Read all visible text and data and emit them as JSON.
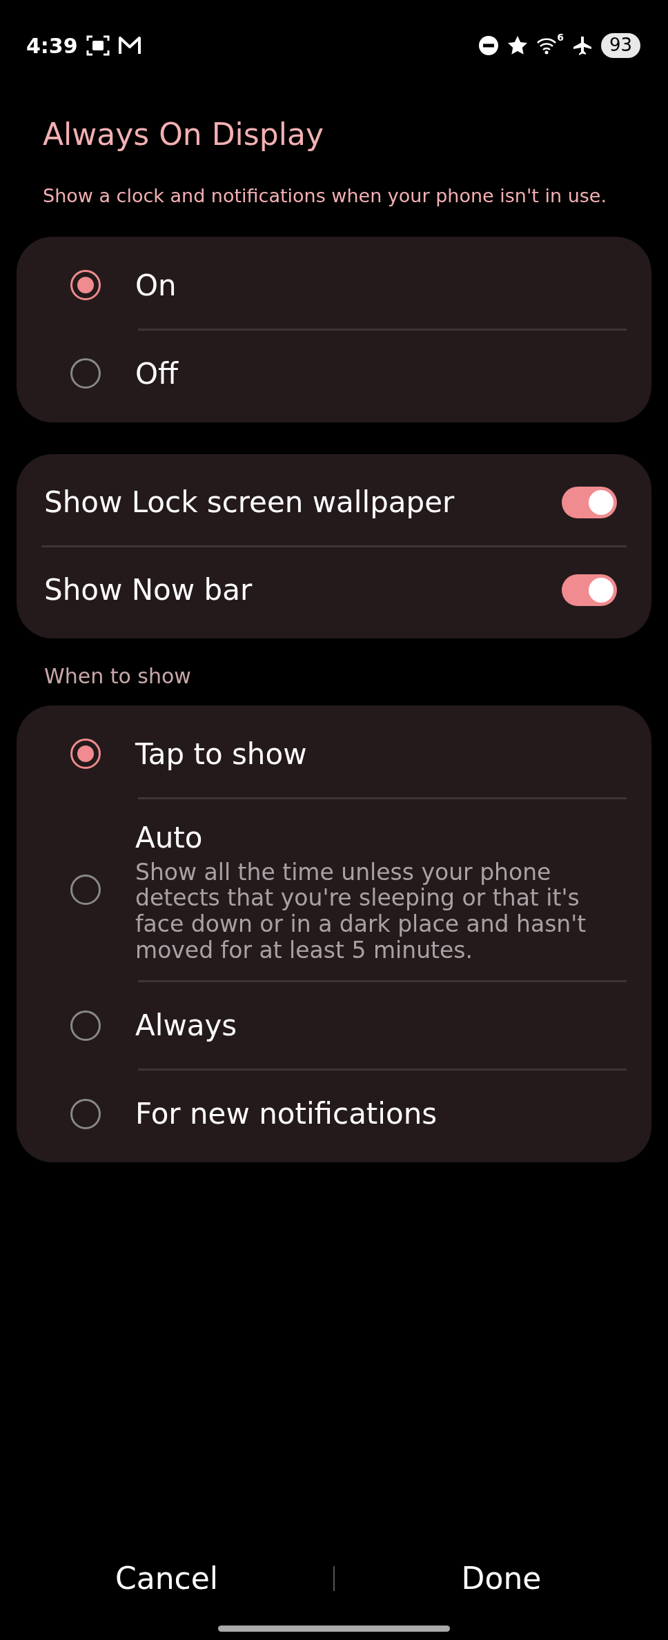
{
  "status_bar": {
    "time": "4:39",
    "wifi_label": "6",
    "battery": "93"
  },
  "title": "Always On Display",
  "subtitle": "Show a clock and notifications when your phone isn't in use.",
  "mode_options": [
    {
      "label": "On",
      "selected": true
    },
    {
      "label": "Off",
      "selected": false
    }
  ],
  "toggles": [
    {
      "label": "Show Lock screen wallpaper",
      "on": true
    },
    {
      "label": "Show Now bar",
      "on": true
    }
  ],
  "when_to_show": {
    "header": "When to show",
    "options": [
      {
        "label": "Tap to show",
        "selected": true
      },
      {
        "label": "Auto",
        "description": "Show all the time unless your phone detects that you're sleeping or that it's face down or in a dark place and hasn't moved for at least 5 minutes.",
        "selected": false
      },
      {
        "label": "Always",
        "selected": false
      },
      {
        "label": "For new notifications",
        "selected": false
      }
    ]
  },
  "buttons": [
    "Cancel",
    "Done"
  ]
}
